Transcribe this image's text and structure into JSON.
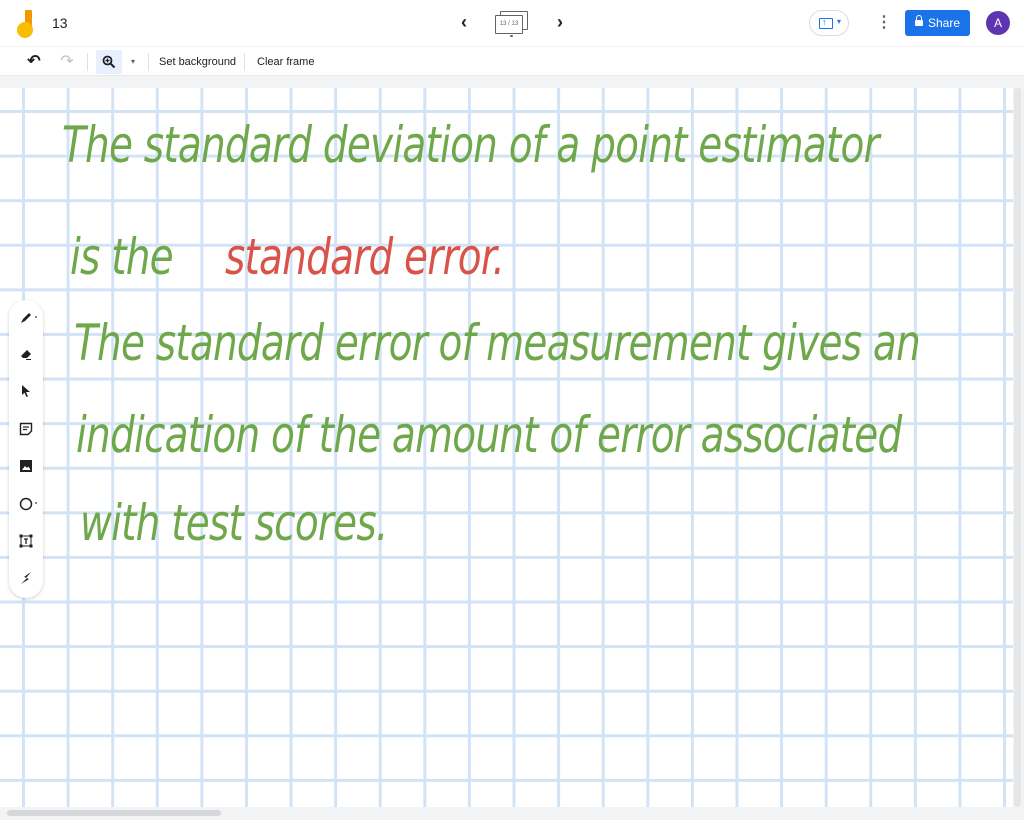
{
  "app": {
    "title": "13",
    "logo_icon": "jamboard-logo-icon"
  },
  "frame_nav": {
    "prev_icon": "chevron-left-icon",
    "next_icon": "chevron-right-icon",
    "frame_counter": "13 / 13"
  },
  "header_actions": {
    "present_icon": "present-to-screen-icon",
    "more_icon": "more-vert-icon",
    "share_label": "Share",
    "share_icon": "lock-icon",
    "avatar_initial": "A"
  },
  "toolbar": {
    "undo_icon": "undo-icon",
    "redo_icon": "redo-icon",
    "zoom_icon": "zoom-in-icon",
    "zoom_caret_icon": "caret-down-icon",
    "set_background_label": "Set background",
    "clear_frame_label": "Clear frame"
  },
  "side_tools": [
    {
      "name": "pen",
      "icon": "pen-icon"
    },
    {
      "name": "eraser",
      "icon": "eraser-icon"
    },
    {
      "name": "select",
      "icon": "cursor-icon"
    },
    {
      "name": "sticky-note",
      "icon": "sticky-note-icon"
    },
    {
      "name": "image",
      "icon": "image-icon"
    },
    {
      "name": "circle",
      "icon": "circle-icon"
    },
    {
      "name": "text-box",
      "icon": "text-box-icon"
    },
    {
      "name": "laser",
      "icon": "laser-icon"
    }
  ],
  "canvas": {
    "background": "grid",
    "colors": {
      "green_ink": "#6ea84a",
      "red_ink": "#d9534a",
      "grid": "#d2e3f6"
    },
    "lines": [
      {
        "segments": [
          {
            "text": "The standard deviation of a point estimator",
            "color": "green"
          }
        ]
      },
      {
        "segments": [
          {
            "text": "is the",
            "color": "green"
          },
          {
            "text": "standard error.",
            "color": "red"
          }
        ]
      },
      {
        "segments": [
          {
            "text": "The standard error of measurement gives an",
            "color": "green"
          }
        ]
      },
      {
        "segments": [
          {
            "text": "indication of the amount of error associated",
            "color": "green"
          }
        ]
      },
      {
        "segments": [
          {
            "text": "with test scores.",
            "color": "green"
          }
        ]
      }
    ]
  }
}
